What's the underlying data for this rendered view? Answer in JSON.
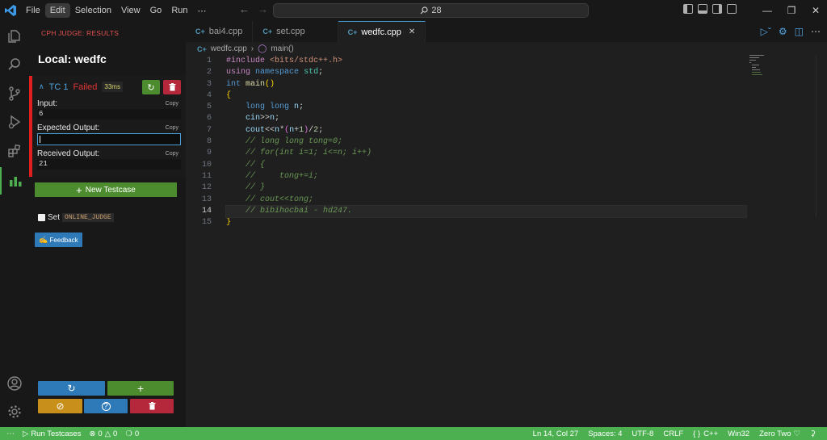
{
  "menu": [
    "File",
    "Edit",
    "Selection",
    "View",
    "Go",
    "Run",
    "⋯"
  ],
  "search": {
    "text": "28"
  },
  "sidebar": {
    "title": "CPH JUDGE: RESULTS",
    "header": "Local: wedfc",
    "testcase": {
      "name": "TC 1",
      "status": "Failed",
      "time": "33ms",
      "input_label": "Input:",
      "input_value": "6",
      "expected_label": "Expected Output:",
      "expected_value": "",
      "received_label": "Received Output:",
      "received_value": "21",
      "copy_label": "Copy"
    },
    "new_testcase_label": "New Testcase",
    "set_label": "Set",
    "online_judge_label": "ONLINE_JUDGE",
    "feedback_label": "Feedback"
  },
  "tabs": [
    {
      "label": "bai4.cpp"
    },
    {
      "label": "set.cpp"
    },
    {
      "label": "wedfc.cpp"
    }
  ],
  "breadcrumb": {
    "file": "wedfc.cpp",
    "symbol": "main()"
  },
  "code_lines": [
    {
      "n": "1",
      "html": "<span style='color:#c586c0'>#include</span> <span style='color:#ce9178'>&lt;bits/stdc++.h&gt;</span>"
    },
    {
      "n": "2",
      "html": "<span style='color:#c586c0'>using</span> <span style='color:#569cd6'>namespace</span> <span style='color:#4ec9b0'>std</span>;"
    },
    {
      "n": "3",
      "html": "<span style='color:#569cd6'>int</span> <span style='color:#dcdcaa'>main</span><span style='color:#ffd700'>()</span>"
    },
    {
      "n": "4",
      "html": "<span style='color:#ffd700'>{</span>"
    },
    {
      "n": "5",
      "html": "    <span style='color:#569cd6'>long long</span> <span style='color:#9cdcfe'>n</span>;"
    },
    {
      "n": "6",
      "html": "    <span style='color:#9cdcfe'>cin</span>&gt;&gt;<span style='color:#9cdcfe'>n</span>;"
    },
    {
      "n": "7",
      "html": "    <span style='color:#9cdcfe'>cout</span>&lt;&lt;<span style='color:#9cdcfe'>n</span>*<span style='color:#da70d6'>(</span><span style='color:#9cdcfe'>n</span>+<span style='color:#b5cea8'>1</span><span style='color:#da70d6'>)</span>/<span style='color:#b5cea8'>2</span>;"
    },
    {
      "n": "8",
      "html": "    <span style='color:#6a9955;font-style:italic'>// long long tong=0;</span>"
    },
    {
      "n": "9",
      "html": "    <span style='color:#6a9955;font-style:italic'>// for(int i=1; i&lt;=n; i++)</span>"
    },
    {
      "n": "10",
      "html": "    <span style='color:#6a9955;font-style:italic'>// {</span>"
    },
    {
      "n": "11",
      "html": "    <span style='color:#6a9955;font-style:italic'>//     tong+=i;</span>"
    },
    {
      "n": "12",
      "html": "    <span style='color:#6a9955;font-style:italic'>// }</span>"
    },
    {
      "n": "13",
      "html": "    <span style='color:#6a9955;font-style:italic'>// cout&lt;&lt;tong;</span>"
    },
    {
      "n": "14",
      "html": "    <span style='color:#6a9955;font-style:italic'>// bibihocbai - hd247.</span>"
    },
    {
      "n": "15",
      "html": "<span style='color:#ffd700'>}</span>"
    }
  ],
  "current_line": "14",
  "status": {
    "run_testcases": "Run Testcases",
    "errors": "0",
    "warnings": "0",
    "ports": "0",
    "position": "Ln 14, Col 27",
    "spaces": "Spaces: 4",
    "encoding": "UTF-8",
    "eol": "CRLF",
    "language": "C++",
    "platform": "Win32",
    "theme": "Zero Two"
  },
  "colors": {
    "accent": "#4caf50",
    "fail": "#e02020",
    "link": "#4a9cd6"
  }
}
